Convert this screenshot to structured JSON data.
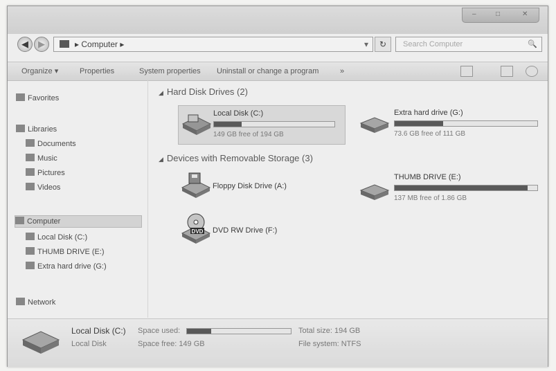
{
  "window": {
    "controls": {
      "minimize": "–",
      "maximize": "□",
      "close": "✕"
    }
  },
  "address_bar": {
    "back_icon": "back-arrow-icon",
    "forward_icon": "forward-arrow-icon",
    "path": "▸ Computer ▸",
    "dropdown": "▾",
    "refresh": "↻",
    "search_placeholder": "Search Computer",
    "search_icon": "🔍"
  },
  "toolbar": {
    "organize": "Organize ▾",
    "properties": "Properties",
    "system_properties": "System properties",
    "uninstall": "Uninstall or change a program",
    "more": "»"
  },
  "nav_pane": {
    "favorites": "Favorites",
    "libraries": "Libraries",
    "documents": "Documents",
    "music": "Music",
    "pictures": "Pictures",
    "videos": "Videos",
    "computer": "Computer",
    "local_disk": "Local Disk (C:)",
    "thumb_drive": "THUMB DRIVE (E:)",
    "extra_drive": "Extra hard drive (G:)",
    "network": "Network"
  },
  "content": {
    "hard_disk_group": "Hard Disk Drives (2)",
    "removable_group": "Devices with Removable Storage (3)",
    "drives": {
      "local_c": {
        "name": "Local Disk (C:)",
        "free": "149 GB free of 194 GB",
        "used_fraction": 0.23
      },
      "extra_g": {
        "name": "Extra hard drive (G:)",
        "free": "73.6 GB free of 111 GB",
        "used_fraction": 0.34
      },
      "floppy": {
        "name": "Floppy Disk Drive (A:)"
      },
      "dvd": {
        "name": "DVD RW Drive (F:)",
        "badge": "DVD"
      },
      "thumb_e": {
        "name": "THUMB DRIVE (E:)",
        "free": "137 MB free of 1.86 GB",
        "used_fraction": 0.93
      }
    }
  },
  "details": {
    "name": "Local Disk (C:)",
    "type": "Local Disk",
    "space_used_label": "Space used:",
    "space_used_fraction": 0.23,
    "space_free": "Space free: 149 GB",
    "total_size": "Total size: 194 GB",
    "file_system": "File system: NTFS"
  }
}
